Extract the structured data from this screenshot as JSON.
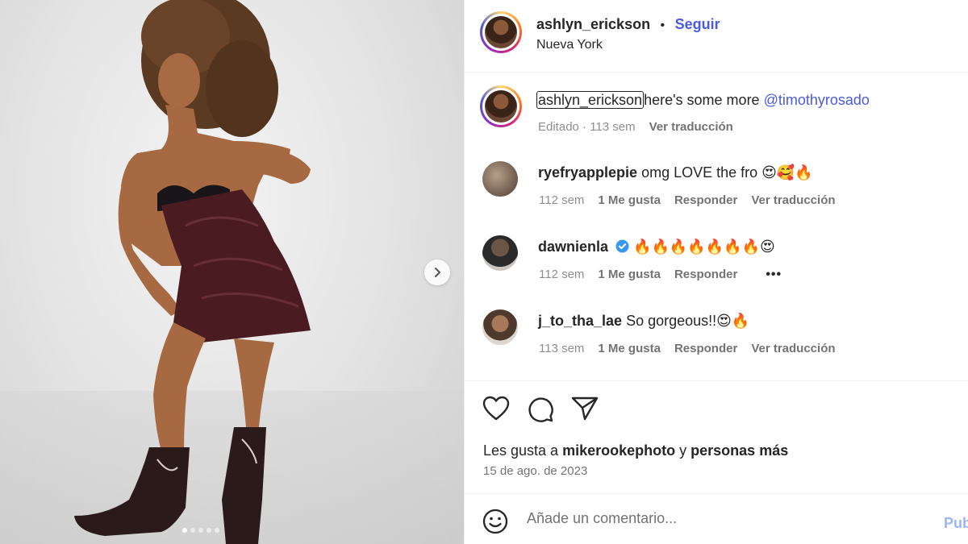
{
  "post": {
    "author": "ashlyn_erickson",
    "separator": "•",
    "follow_label": "Seguir",
    "location": "Nueva York",
    "caption": {
      "username": "ashlyn_erickson",
      "text": "here's some more",
      "mention": "@timothyrosado",
      "edited": "Editado · 113 sem",
      "translate": "Ver traducción"
    }
  },
  "media": {
    "slides": 5,
    "active_slide": 1,
    "next_icon": "chevron-right-icon"
  },
  "comments": [
    {
      "username": "ryefryapplepie",
      "text": "omg LOVE the fro 😍🥰🔥",
      "age": "112 sem",
      "likes": "1 Me gusta",
      "reply": "Responder",
      "translate": "Ver traducción",
      "verified": false
    },
    {
      "username": "dawnienla",
      "text": "🔥🔥🔥🔥🔥🔥🔥😍",
      "age": "112 sem",
      "likes": "1 Me gusta",
      "reply": "Responder",
      "more": "•••",
      "verified": true
    },
    {
      "username": "j_to_tha_lae",
      "text": "So gorgeous!!😍🔥",
      "age": "113 sem",
      "likes": "1 Me gusta",
      "reply": "Responder",
      "translate": "Ver traducción",
      "verified": false
    }
  ],
  "actions": {
    "like_icon": "heart-icon",
    "comment_icon": "comment-bubble-icon",
    "share_icon": "paper-plane-icon",
    "likes_prefix": "Les gusta a",
    "likes_user": "mikerookephoto",
    "likes_conj": "y",
    "likes_rest": "personas más",
    "date": "15 de ago. de 2023"
  },
  "add_comment": {
    "emoji_icon": "smiley-icon",
    "placeholder": "Añade un comentario...",
    "publish_label": "Publicar"
  },
  "colors": {
    "link_blue": "#4a5bdf",
    "muted": "#8e8e8e",
    "publish_disabled": "#9fb4f5"
  }
}
